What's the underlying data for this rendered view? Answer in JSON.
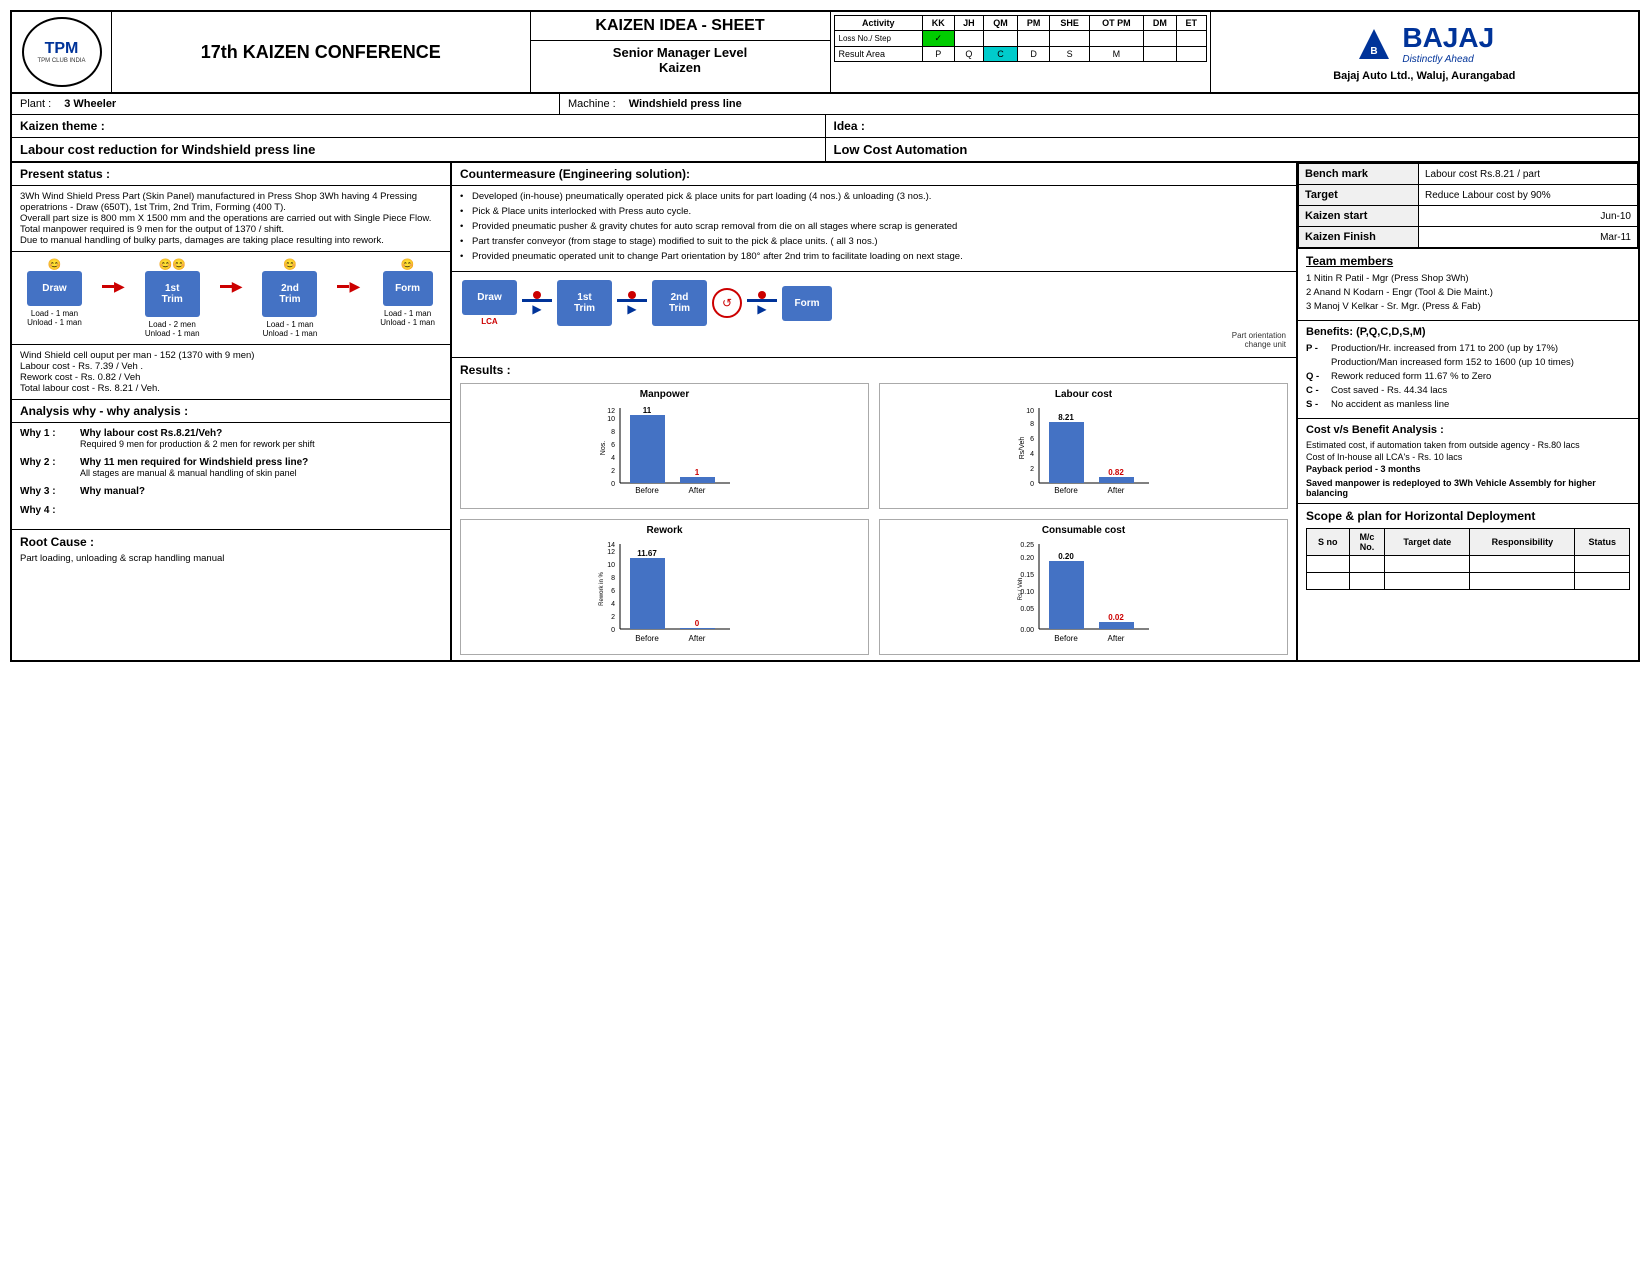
{
  "header": {
    "conference_title": "17th KAIZEN CONFERENCE",
    "kaizen_sheet_title": "KAIZEN IDEA - SHEET",
    "level_title": "Senior Manager Level",
    "level_sub": "Kaizen",
    "bajaj_name": "BAJAJ",
    "bajaj_tagline": "Distinctly Ahead",
    "bajaj_address": "Bajaj Auto Ltd., Waluj, Aurangabad"
  },
  "activity_table": {
    "headers": [
      "Activity",
      "KK",
      "JH",
      "QM",
      "PM",
      "SHE",
      "OT PM",
      "DM",
      "ET"
    ],
    "row1_label": "Loss No./ Step",
    "row2_label": "Result Area",
    "row2_vals": [
      "P",
      "Q",
      "C",
      "D",
      "S",
      "M"
    ],
    "green_col": 1,
    "cyan_col": 3
  },
  "plant": {
    "label": "Plant :",
    "value": "3 Wheeler",
    "machine_label": "Machine :",
    "machine_value": "Windshield press line"
  },
  "kaizen_theme": {
    "label": "Kaizen theme :",
    "value": "Labour cost reduction for Windshield press line",
    "idea_label": "Idea  :",
    "idea_value": "Low Cost Automation"
  },
  "present_status": {
    "title": "Present status :",
    "body": "3Wh Wind Shield Press Part (Skin Panel) manufactured in Press Shop 3Wh having 4 Pressing operatrions - Draw (650T), 1st Trim, 2nd Trim, Forming (400 T).\nOverall part size is 800 mm X 1500 mm and the operations are carried out with Single Piece Flow.\nTotal manpower required is 9 men for the output of 1370 / shift.\nDue to manual handling of bulky parts, damages are taking place resulting into rework.",
    "process_steps": [
      "Draw",
      "1st\nTrim",
      "2nd\nTrim",
      "Form"
    ],
    "loads": [
      "Load  - 1 man\nUnload - 1 man",
      "Load  - 2 men\nUnload - 1 man",
      "Load  - 1 man\nUnload - 1 man",
      "Load  - 1 man\nUnload - 1 man"
    ]
  },
  "stats": {
    "wind_shield": "Wind Shield cell ouput per man - 152 (1370 with 9 men)",
    "labour_cost": "Labour cost        - Rs. 7.39 /  Veh .",
    "rework_cost": "Rework cost       - Rs. 0.82 / Veh",
    "total_labour": "Total labour cost  - Rs. 8.21 / Veh."
  },
  "analysis": {
    "title": "Analysis why - why analysis :",
    "why1_label": "Why 1 :",
    "why1_q": "Why labour cost Rs.8.21/Veh?",
    "why1_a": "Required 9 men for production & 2 men for rework per shift",
    "why2_label": "Why 2 :",
    "why2_q": "Why 11 men required for Windshield press line?",
    "why2_a": "All stages are manual & manual handling of skin panel",
    "why3_label": "Why 3 :",
    "why3_q": "Why manual?",
    "why4_label": "Why 4 :"
  },
  "countermeasure": {
    "title": "Countermeasure (Engineering solution):",
    "items": [
      "Developed (in-house) pneumatically operated pick & place units for part loading (4 nos.) & unloading (3 nos.).",
      "Pick & Place units interlocked with Press auto cycle.",
      "Provided pneumatic pusher & gravity chutes for auto scrap removal from die on all stages where scrap is generated",
      "Part transfer conveyor (from stage to stage) modified to suit to the pick & place units. ( all 3 nos.)",
      "Provided pneumatic operated unit to change Part orientation by 180° after 2nd trim to facilitate loading on next stage."
    ]
  },
  "after_process": {
    "steps": [
      "Draw",
      "1st\nTrim",
      "2nd\nTrim",
      "Form"
    ],
    "lca_label": "LCA",
    "orientation_label": "Part orientation\nchange unit"
  },
  "results": {
    "title": "Results :",
    "manpower_chart": {
      "title": "Manpower",
      "before_val": 11,
      "after_val": 1,
      "before_label": "Before",
      "after_label": "After",
      "y_label": "Nos.",
      "max": 12
    },
    "labour_chart": {
      "title": "Labour cost",
      "before_val": 8.21,
      "after_val": 0.82,
      "before_label": "Before",
      "after_label": "After",
      "y_label": "Rs/Veh",
      "max": 10
    },
    "rework_chart": {
      "title": "Rework",
      "before_val": 11.67,
      "after_val": 0,
      "before_label": "Before",
      "after_label": "After",
      "y_label": "Rework in %",
      "max": 14
    },
    "consumable_chart": {
      "title": "Consumable cost",
      "before_val": 0.2,
      "after_val": 0.02,
      "before_label": "Before",
      "after_label": "After",
      "y_label": "Rs / Veh",
      "max": 0.25
    }
  },
  "bench_mark": {
    "label": "Bench mark",
    "value": "Labour cost Rs.8.21 / part",
    "target_label": "Target",
    "target_value": "Reduce Labour cost by 90%",
    "kaizen_start_label": "Kaizen start",
    "kaizen_start_value": "Jun-10",
    "kaizen_finish_label": "Kaizen Finish",
    "kaizen_finish_value": "Mar-11"
  },
  "team": {
    "title": "Team members",
    "members": [
      "1    Nitin R Patil - Mgr (Press Shop 3Wh)",
      "2    Anand N Kodarn - Engr (Tool & Die Maint.)",
      "3    Manoj V Kelkar - Sr. Mgr. (Press & Fab)"
    ]
  },
  "benefits": {
    "title": "Benefits: (P,Q,C,D,S,M)",
    "items": [
      {
        "label": "P -",
        "text": "Production/Hr. increased from 171 to 200 (up by 17%)"
      },
      {
        "label": "",
        "text": "Production/Man increased form 152 to 1600 (up 10 times)"
      },
      {
        "label": "Q -",
        "text": "Rework reduced form 11.67 % to Zero"
      },
      {
        "label": "C -",
        "text": "Cost saved - Rs. 44.34 lacs"
      },
      {
        "label": "S -",
        "text": "No accident as manless line"
      }
    ]
  },
  "cost_analysis": {
    "title": "Cost v/s Benefit Analysis :",
    "line1": "Estimated cost, if automation taken from outside agency - Rs.80 lacs",
    "line2": "Cost of In-house all LCA's                                          - Rs. 10 lacs",
    "payback_label": "Payback period",
    "payback_value": "- 3 months",
    "saved_text": "Saved manpower is redeployed to 3Wh Vehicle Assembly for higher balancing"
  },
  "scope": {
    "title": "Scope & plan for Horizontal Deployment",
    "table_headers": [
      "S no",
      "M/c\nNo.",
      "Target date",
      "Responsibility",
      "Status"
    ]
  },
  "root_cause": {
    "title": "Root Cause :",
    "value": "Part loading, unloading & scrap handling manual"
  }
}
